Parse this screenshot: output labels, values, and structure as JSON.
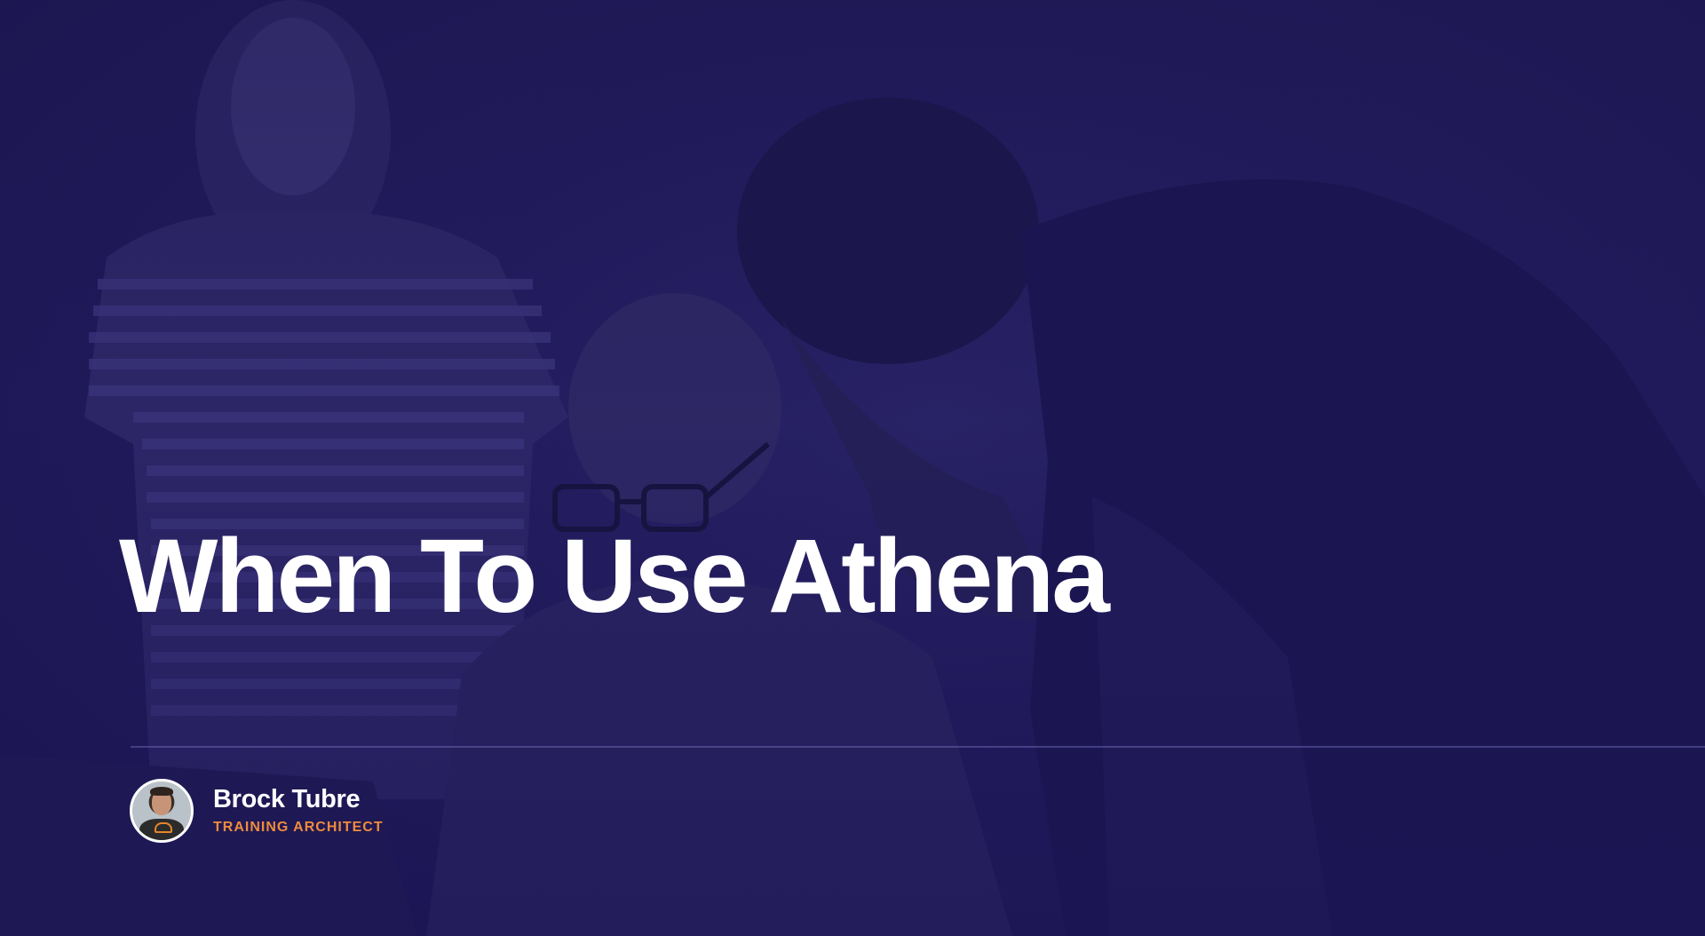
{
  "slide": {
    "title": "When To Use Athena",
    "presenter": {
      "name": "Brock Tubre",
      "role": "TRAINING ARCHITECT"
    }
  },
  "colors": {
    "background": "#221c5e",
    "title": "#ffffff",
    "role_accent": "#f08a3c"
  }
}
